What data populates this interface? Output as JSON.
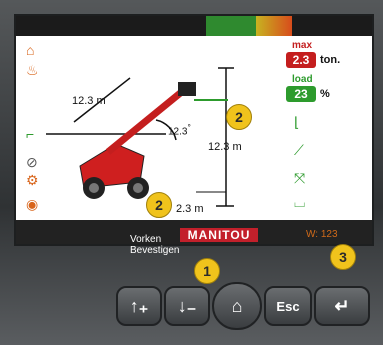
{
  "load_chart": {
    "max_label": "max",
    "max_value": "2.3",
    "max_unit": "ton.",
    "load_label": "load",
    "load_value": "23",
    "load_unit": "%"
  },
  "diagram": {
    "reach_top": "12.3  m",
    "reach_mid": "12.3 m",
    "angle": "12.3",
    "height": "12.3 m",
    "extension": "2.3 m"
  },
  "callouts": [
    "1",
    "2",
    "2",
    "3"
  ],
  "message_lines": [
    "Vorken",
    "Bevestigen"
  ],
  "brand": "MANITOU",
  "weight_readout": "W:  123",
  "buttons": {
    "esc_label": "Esc"
  }
}
